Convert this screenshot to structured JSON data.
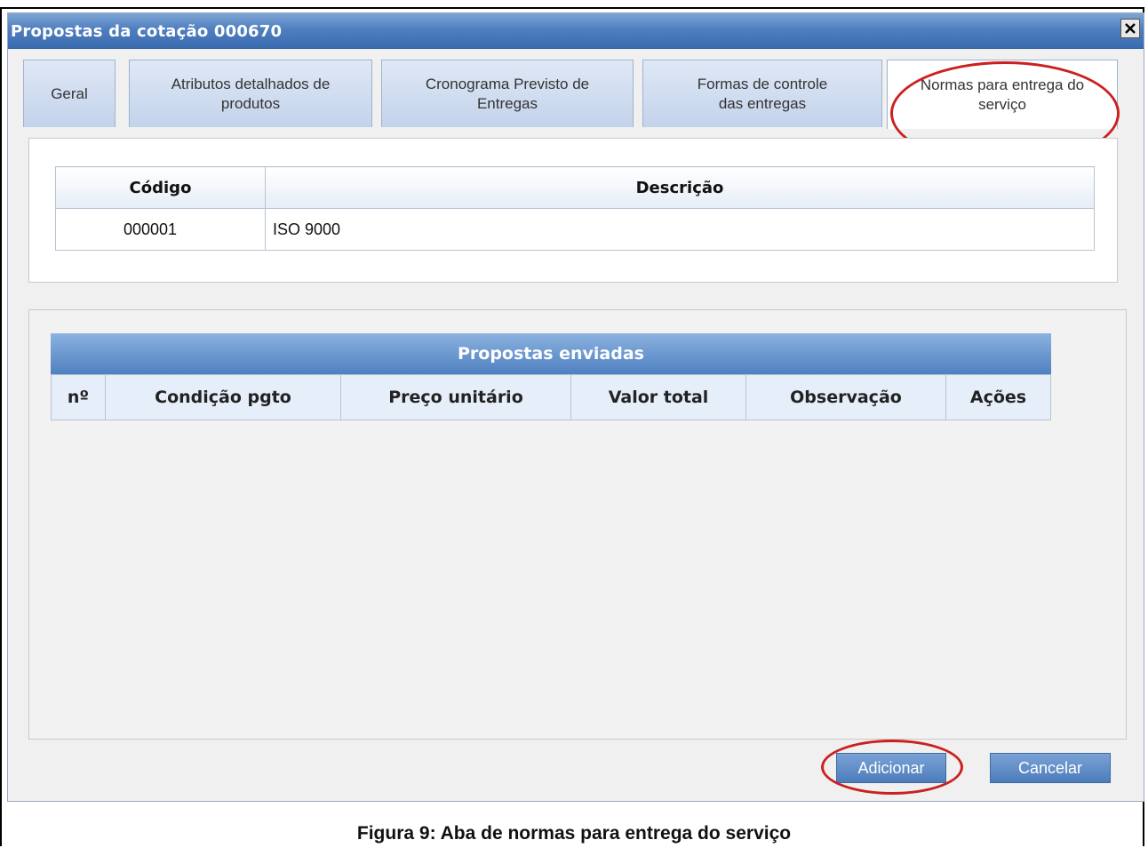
{
  "window": {
    "title": "Propostas da cotação 000670"
  },
  "tabs": [
    {
      "label": "Geral"
    },
    {
      "label": "Atributos detalhados de produtos"
    },
    {
      "label": "Cronograma Previsto de Entregas"
    },
    {
      "label": "Formas de controle das entregas"
    },
    {
      "label": "Normas para entrega do serviço"
    }
  ],
  "norms_table": {
    "headers": {
      "code": "Código",
      "description": "Descrição"
    },
    "rows": [
      {
        "code": "000001",
        "description": "ISO 9000"
      }
    ]
  },
  "proposals": {
    "title": "Propostas enviadas",
    "columns": [
      "nº",
      "Condição pgto",
      "Preço unitário",
      "Valor total",
      "Observação",
      "Ações"
    ]
  },
  "buttons": {
    "add": "Adicionar",
    "cancel": "Cancelar"
  },
  "caption": "Figura 9: Aba de normas para entrega do serviço",
  "colors": {
    "titlebar": "#4f7fbf",
    "annotation": "#cc2020"
  }
}
